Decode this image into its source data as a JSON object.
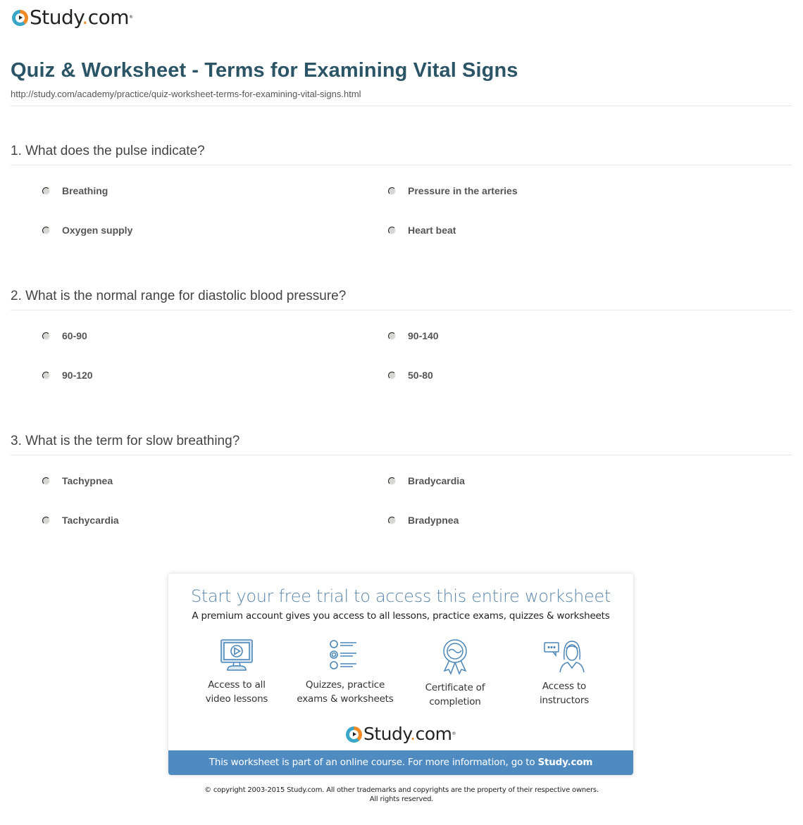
{
  "logo": {
    "name": "Study",
    "dot": ".",
    "tld": "com",
    "tm": "®",
    "icon": "play-circle-logo-icon"
  },
  "page": {
    "title": "Quiz & Worksheet - Terms for Examining Vital Signs",
    "url": "http://study.com/academy/practice/quiz-worksheet-terms-for-examining-vital-signs.html"
  },
  "questions": [
    {
      "text": "1. What does the pulse indicate?",
      "options": [
        "Breathing",
        "Pressure in the arteries",
        "Oxygen supply",
        "Heart beat"
      ]
    },
    {
      "text": "2. What is the normal range for diastolic blood pressure?",
      "options": [
        "60-90",
        "90-140",
        "90-120",
        "50-80"
      ]
    },
    {
      "text": "3. What is the term for slow breathing?",
      "options": [
        "Tachypnea",
        "Bradycardia",
        "Tachycardia",
        "Bradypnea"
      ]
    }
  ],
  "promo": {
    "title": "Start your free trial to access this entire worksheet",
    "subtitle": "A premium account gives you access to all lessons, practice exams, quizzes & worksheets",
    "features": [
      {
        "icon": "monitor-play-icon",
        "line1": "Access to all",
        "line2": "video lessons"
      },
      {
        "icon": "quiz-list-icon",
        "line1": "Quizzes, practice",
        "line2": "exams & worksheets"
      },
      {
        "icon": "certificate-ribbon-icon",
        "line1": "Certificate of",
        "line2": "completion"
      },
      {
        "icon": "instructor-chat-icon",
        "line1": "Access to",
        "line2": "instructors"
      }
    ],
    "bar_text": "This worksheet is part of an online course. For more information, go to ",
    "bar_link": "Study.com",
    "colors": {
      "title": "#5b86ab",
      "bar": "#4f8bc1",
      "icon": "#4a86b8"
    }
  },
  "copyright": {
    "line1": "© copyright 2003-2015 Study.com. All other trademarks and copyrights are the property of their respective owners.",
    "line2": "All rights reserved."
  },
  "colors": {
    "title": "#2b5566",
    "brand_orange": "#f08a24",
    "brand_teal": "#3aa7c9"
  }
}
